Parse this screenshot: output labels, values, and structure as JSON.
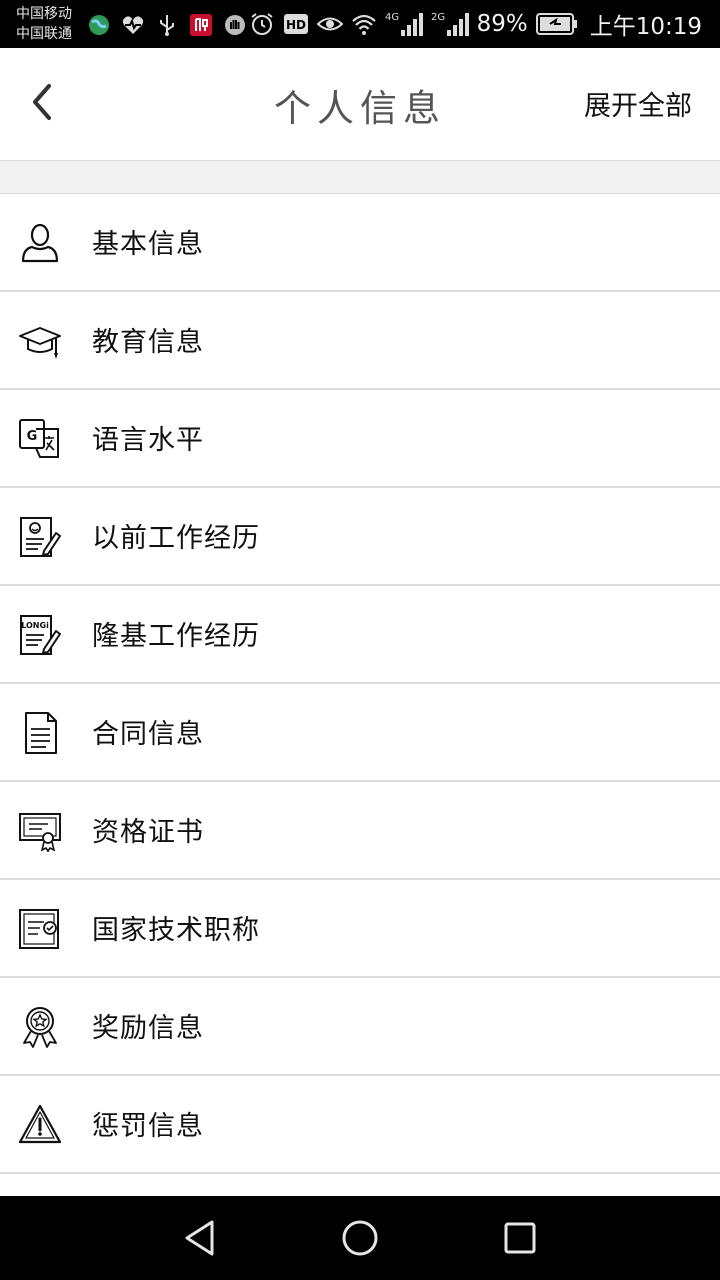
{
  "status_bar": {
    "carrier_1": "中国移动",
    "carrier_2": "中国联通",
    "network_1": "4G",
    "network_2": "2G",
    "battery": "89%",
    "time": "上午10:19"
  },
  "header": {
    "title": "个人信息",
    "action_label": "展开全部"
  },
  "menu": {
    "items": [
      {
        "label": "基本信息",
        "icon": "user-icon"
      },
      {
        "label": "教育信息",
        "icon": "graduation-cap-icon"
      },
      {
        "label": "语言水平",
        "icon": "translate-icon"
      },
      {
        "label": "以前工作经历",
        "icon": "resume-edit-icon"
      },
      {
        "label": "隆基工作经历",
        "icon": "longi-document-icon"
      },
      {
        "label": "合同信息",
        "icon": "document-icon"
      },
      {
        "label": "资格证书",
        "icon": "certificate-icon"
      },
      {
        "label": "国家技术职称",
        "icon": "verified-certificate-icon"
      },
      {
        "label": "奖励信息",
        "icon": "award-icon"
      },
      {
        "label": "惩罚信息",
        "icon": "warning-icon"
      }
    ]
  },
  "nav": {
    "buttons": [
      "back",
      "home",
      "recents"
    ]
  }
}
